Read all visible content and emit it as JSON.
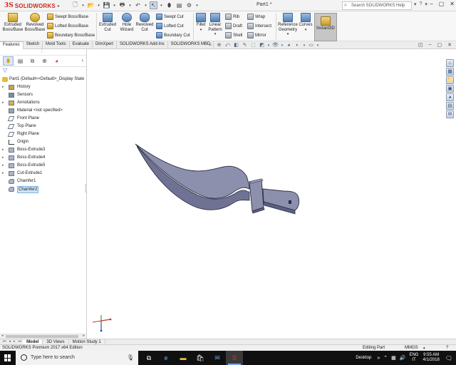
{
  "app": {
    "brand_ds": "3S",
    "brand_name": "SOLIDWORKS",
    "document_title": "Part1 *",
    "help_search_placeholder": "Search SOLIDWORKS Help",
    "window_controls": [
      "–",
      "▢",
      "✕"
    ]
  },
  "ribbon": {
    "extruded_boss": "Extruded Boss/Base",
    "revolved_boss": "Revolved Boss/Base",
    "swept_boss": "Swept Boss/Base",
    "lofted_boss": "Lofted Boss/Base",
    "boundary_boss": "Boundary Boss/Base",
    "extruded_cut": "Extruded Cut",
    "hole_wizard": "Hole Wizard",
    "revolved_cut": "Revolved Cut",
    "swept_cut": "Swept Cut",
    "lofted_cut": "Lofted Cut",
    "boundary_cut": "Boundary Cut",
    "fillet": "Fillet",
    "linear_pattern": "Linear Pattern",
    "rib": "Rib",
    "draft": "Draft",
    "shell": "Shell",
    "wrap": "Wrap",
    "intersect": "Intersect",
    "mirror": "Mirror",
    "reference_geometry": "Reference Geometry",
    "curves": "Curves",
    "instant3d": "Instant3D"
  },
  "tabs": [
    "Features",
    "Sketch",
    "Mold Tools",
    "Evaluate",
    "DimXpert",
    "SOLIDWORKS Add-Ins",
    "SOLIDWORKS MBD"
  ],
  "feature_tree": {
    "root": "Part1  (Default<<Default>_Display State",
    "items": [
      {
        "label": "History",
        "expandable": true
      },
      {
        "label": "Sensors",
        "expandable": false
      },
      {
        "label": "Annotations",
        "expandable": true
      },
      {
        "label": "Material <not specified>",
        "expandable": false
      },
      {
        "label": "Front Plane",
        "expandable": false
      },
      {
        "label": "Top Plane",
        "expandable": false
      },
      {
        "label": "Right Plane",
        "expandable": false
      },
      {
        "label": "Origin",
        "expandable": false
      },
      {
        "label": "Boss-Extrude3",
        "expandable": true
      },
      {
        "label": "Boss-Extrude4",
        "expandable": true
      },
      {
        "label": "Boss-Extrude5",
        "expandable": true
      },
      {
        "label": "Cut-Extrude1",
        "expandable": true
      },
      {
        "label": "Chamfer1",
        "expandable": false
      },
      {
        "label": "Chamfer2",
        "expandable": false,
        "selected": true
      }
    ]
  },
  "bottom_tabs": [
    "Model",
    "3D Views",
    "Motion Study 1"
  ],
  "status": {
    "edition": "SOLIDWORKS Premium 2017 x64 Edition",
    "mode": "Editing Part",
    "units": "MMGS",
    "help": "?"
  },
  "taskbar": {
    "search_placeholder": "Type here to search",
    "desktop_label": "Desktop",
    "lang_line1": "ENG",
    "lang_line2": "IT",
    "time": "9:55 AM",
    "date": "4/1/2018"
  },
  "colors": {
    "solidworks_red": "#d3261c",
    "model_face": "#8d90ad",
    "model_edge": "#2b2d44",
    "taskbar_bg": "#101010"
  }
}
